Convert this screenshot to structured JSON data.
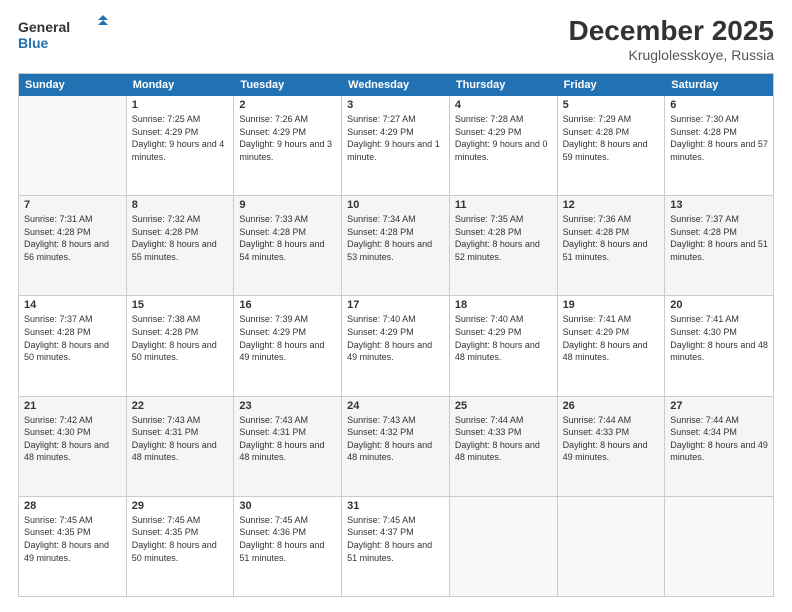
{
  "header": {
    "logo_line1": "General",
    "logo_line2": "Blue",
    "title": "December 2025",
    "subtitle": "Kruglolesskoye, Russia"
  },
  "days": [
    "Sunday",
    "Monday",
    "Tuesday",
    "Wednesday",
    "Thursday",
    "Friday",
    "Saturday"
  ],
  "weeks": [
    [
      {
        "date": "",
        "sunrise": "",
        "sunset": "",
        "daylight": ""
      },
      {
        "date": "1",
        "sunrise": "Sunrise: 7:25 AM",
        "sunset": "Sunset: 4:29 PM",
        "daylight": "Daylight: 9 hours and 4 minutes."
      },
      {
        "date": "2",
        "sunrise": "Sunrise: 7:26 AM",
        "sunset": "Sunset: 4:29 PM",
        "daylight": "Daylight: 9 hours and 3 minutes."
      },
      {
        "date": "3",
        "sunrise": "Sunrise: 7:27 AM",
        "sunset": "Sunset: 4:29 PM",
        "daylight": "Daylight: 9 hours and 1 minute."
      },
      {
        "date": "4",
        "sunrise": "Sunrise: 7:28 AM",
        "sunset": "Sunset: 4:29 PM",
        "daylight": "Daylight: 9 hours and 0 minutes."
      },
      {
        "date": "5",
        "sunrise": "Sunrise: 7:29 AM",
        "sunset": "Sunset: 4:28 PM",
        "daylight": "Daylight: 8 hours and 59 minutes."
      },
      {
        "date": "6",
        "sunrise": "Sunrise: 7:30 AM",
        "sunset": "Sunset: 4:28 PM",
        "daylight": "Daylight: 8 hours and 57 minutes."
      }
    ],
    [
      {
        "date": "7",
        "sunrise": "Sunrise: 7:31 AM",
        "sunset": "Sunset: 4:28 PM",
        "daylight": "Daylight: 8 hours and 56 minutes."
      },
      {
        "date": "8",
        "sunrise": "Sunrise: 7:32 AM",
        "sunset": "Sunset: 4:28 PM",
        "daylight": "Daylight: 8 hours and 55 minutes."
      },
      {
        "date": "9",
        "sunrise": "Sunrise: 7:33 AM",
        "sunset": "Sunset: 4:28 PM",
        "daylight": "Daylight: 8 hours and 54 minutes."
      },
      {
        "date": "10",
        "sunrise": "Sunrise: 7:34 AM",
        "sunset": "Sunset: 4:28 PM",
        "daylight": "Daylight: 8 hours and 53 minutes."
      },
      {
        "date": "11",
        "sunrise": "Sunrise: 7:35 AM",
        "sunset": "Sunset: 4:28 PM",
        "daylight": "Daylight: 8 hours and 52 minutes."
      },
      {
        "date": "12",
        "sunrise": "Sunrise: 7:36 AM",
        "sunset": "Sunset: 4:28 PM",
        "daylight": "Daylight: 8 hours and 51 minutes."
      },
      {
        "date": "13",
        "sunrise": "Sunrise: 7:37 AM",
        "sunset": "Sunset: 4:28 PM",
        "daylight": "Daylight: 8 hours and 51 minutes."
      }
    ],
    [
      {
        "date": "14",
        "sunrise": "Sunrise: 7:37 AM",
        "sunset": "Sunset: 4:28 PM",
        "daylight": "Daylight: 8 hours and 50 minutes."
      },
      {
        "date": "15",
        "sunrise": "Sunrise: 7:38 AM",
        "sunset": "Sunset: 4:28 PM",
        "daylight": "Daylight: 8 hours and 50 minutes."
      },
      {
        "date": "16",
        "sunrise": "Sunrise: 7:39 AM",
        "sunset": "Sunset: 4:29 PM",
        "daylight": "Daylight: 8 hours and 49 minutes."
      },
      {
        "date": "17",
        "sunrise": "Sunrise: 7:40 AM",
        "sunset": "Sunset: 4:29 PM",
        "daylight": "Daylight: 8 hours and 49 minutes."
      },
      {
        "date": "18",
        "sunrise": "Sunrise: 7:40 AM",
        "sunset": "Sunset: 4:29 PM",
        "daylight": "Daylight: 8 hours and 48 minutes."
      },
      {
        "date": "19",
        "sunrise": "Sunrise: 7:41 AM",
        "sunset": "Sunset: 4:29 PM",
        "daylight": "Daylight: 8 hours and 48 minutes."
      },
      {
        "date": "20",
        "sunrise": "Sunrise: 7:41 AM",
        "sunset": "Sunset: 4:30 PM",
        "daylight": "Daylight: 8 hours and 48 minutes."
      }
    ],
    [
      {
        "date": "21",
        "sunrise": "Sunrise: 7:42 AM",
        "sunset": "Sunset: 4:30 PM",
        "daylight": "Daylight: 8 hours and 48 minutes."
      },
      {
        "date": "22",
        "sunrise": "Sunrise: 7:43 AM",
        "sunset": "Sunset: 4:31 PM",
        "daylight": "Daylight: 8 hours and 48 minutes."
      },
      {
        "date": "23",
        "sunrise": "Sunrise: 7:43 AM",
        "sunset": "Sunset: 4:31 PM",
        "daylight": "Daylight: 8 hours and 48 minutes."
      },
      {
        "date": "24",
        "sunrise": "Sunrise: 7:43 AM",
        "sunset": "Sunset: 4:32 PM",
        "daylight": "Daylight: 8 hours and 48 minutes."
      },
      {
        "date": "25",
        "sunrise": "Sunrise: 7:44 AM",
        "sunset": "Sunset: 4:33 PM",
        "daylight": "Daylight: 8 hours and 48 minutes."
      },
      {
        "date": "26",
        "sunrise": "Sunrise: 7:44 AM",
        "sunset": "Sunset: 4:33 PM",
        "daylight": "Daylight: 8 hours and 49 minutes."
      },
      {
        "date": "27",
        "sunrise": "Sunrise: 7:44 AM",
        "sunset": "Sunset: 4:34 PM",
        "daylight": "Daylight: 8 hours and 49 minutes."
      }
    ],
    [
      {
        "date": "28",
        "sunrise": "Sunrise: 7:45 AM",
        "sunset": "Sunset: 4:35 PM",
        "daylight": "Daylight: 8 hours and 49 minutes."
      },
      {
        "date": "29",
        "sunrise": "Sunrise: 7:45 AM",
        "sunset": "Sunset: 4:35 PM",
        "daylight": "Daylight: 8 hours and 50 minutes."
      },
      {
        "date": "30",
        "sunrise": "Sunrise: 7:45 AM",
        "sunset": "Sunset: 4:36 PM",
        "daylight": "Daylight: 8 hours and 51 minutes."
      },
      {
        "date": "31",
        "sunrise": "Sunrise: 7:45 AM",
        "sunset": "Sunset: 4:37 PM",
        "daylight": "Daylight: 8 hours and 51 minutes."
      },
      {
        "date": "",
        "sunrise": "",
        "sunset": "",
        "daylight": ""
      },
      {
        "date": "",
        "sunrise": "",
        "sunset": "",
        "daylight": ""
      },
      {
        "date": "",
        "sunrise": "",
        "sunset": "",
        "daylight": ""
      }
    ]
  ]
}
